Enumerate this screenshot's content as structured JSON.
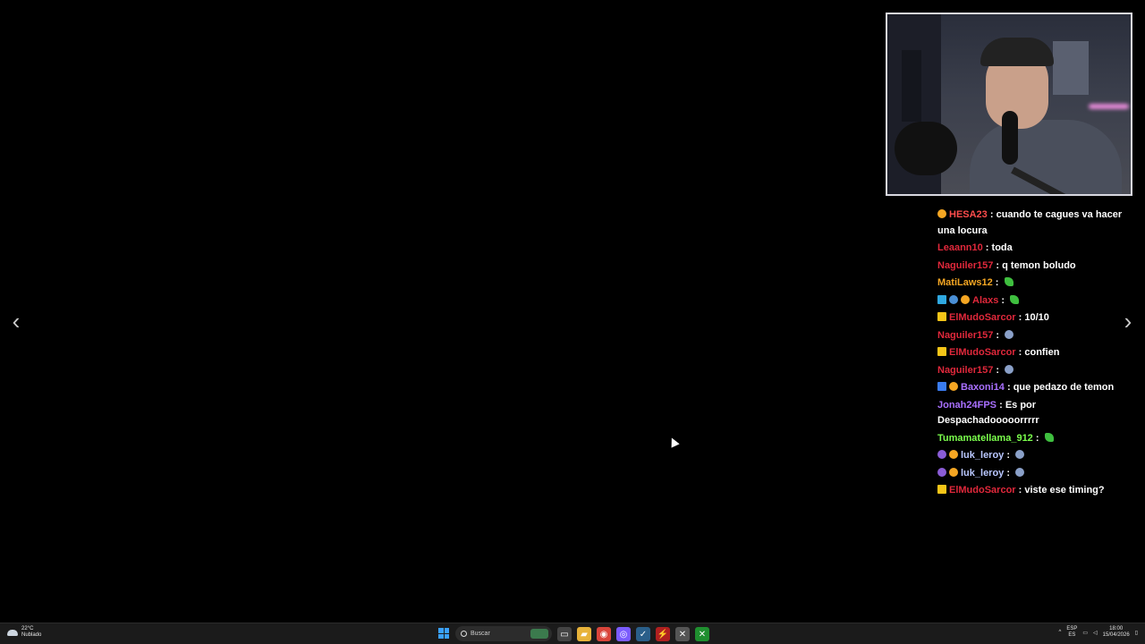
{
  "chat": [
    {
      "badges": [
        "prime"
      ],
      "user": "HESA23",
      "color": "#ff4d4d",
      "text": "cuando te cagues va hacer una locura",
      "emote": ""
    },
    {
      "badges": [],
      "user": "Leaann10",
      "color": "#e0283b",
      "text": "toda",
      "emote": ""
    },
    {
      "badges": [],
      "user": "Naguiler157",
      "color": "#e0283b",
      "text": "q temon boludo",
      "emote": ""
    },
    {
      "badges": [],
      "user": "MatiLaws12",
      "color": "#f5a623",
      "text": "",
      "emote": "pickle-emote"
    },
    {
      "badges": [
        "cube",
        "drop",
        "prime"
      ],
      "user": "Alaxs",
      "color": "#e0283b",
      "text": "",
      "emote": "pickle-emote"
    },
    {
      "badges": [
        "crown"
      ],
      "user": "ElMudoSarcor",
      "color": "#e0283b",
      "text": "10/10",
      "emote": ""
    },
    {
      "badges": [],
      "user": "Naguiler157",
      "color": "#e0283b",
      "text": "",
      "emote": "satellite-emote"
    },
    {
      "badges": [
        "crown"
      ],
      "user": "ElMudoSarcor",
      "color": "#e0283b",
      "text": "confien",
      "emote": ""
    },
    {
      "badges": [],
      "user": "Naguiler157",
      "color": "#e0283b",
      "text": "",
      "emote": "satellite-emote"
    },
    {
      "badges": [
        "sq-blue",
        "prime"
      ],
      "user": "Baxoni14",
      "color": "#a970ff",
      "text": "que pedazo de temon",
      "emote": ""
    },
    {
      "badges": [],
      "user": "Jonah24FPS",
      "color": "#a970ff",
      "text": "Es por Despachadooooorrrrr",
      "emote": ""
    },
    {
      "badges": [],
      "user": "Tumamatellama_912",
      "color": "#7bff4d",
      "text": "",
      "emote": "pickle-emote"
    },
    {
      "badges": [
        "drop-purple",
        "prime"
      ],
      "user": "luk_leroy",
      "color": "#b9c7ff",
      "text": "",
      "emote": "satellite-emote"
    },
    {
      "badges": [
        "drop-purple",
        "prime"
      ],
      "user": "luk_leroy",
      "color": "#b9c7ff",
      "text": "",
      "emote": "satellite-emote"
    },
    {
      "badges": [
        "crown"
      ],
      "user": "ElMudoSarcor",
      "color": "#e0283b",
      "text": "viste ese timing?",
      "emote": ""
    }
  ],
  "nav": {
    "prev_icon": "chevron-left-icon",
    "next_icon": "chevron-right-icon",
    "prev": "‹",
    "next": "›"
  },
  "taskbar": {
    "weather_temp": "22°C",
    "weather_desc": "Nublado",
    "search_placeholder": "Buscar",
    "lang_top": "ESP",
    "lang_bottom": "ES",
    "time": "18:00",
    "date": "15/04/2026",
    "apps": [
      {
        "name": "task-view-icon",
        "glyph": "▭",
        "bg": "#444"
      },
      {
        "name": "file-explorer-icon",
        "glyph": "▰",
        "bg": "#e8b33a"
      },
      {
        "name": "chrome-icon",
        "glyph": "◉",
        "bg": "#d9453b"
      },
      {
        "name": "messenger-icon",
        "glyph": "◎",
        "bg": "#7b5cff"
      },
      {
        "name": "steam-icon",
        "glyph": "✓",
        "bg": "#2a5f8a"
      },
      {
        "name": "red-app-icon",
        "glyph": "⚡",
        "bg": "#b02020"
      },
      {
        "name": "capture-tool-icon",
        "glyph": "✕",
        "bg": "#555"
      },
      {
        "name": "xbox-icon",
        "glyph": "✕",
        "bg": "#1f8f2f"
      }
    ]
  }
}
